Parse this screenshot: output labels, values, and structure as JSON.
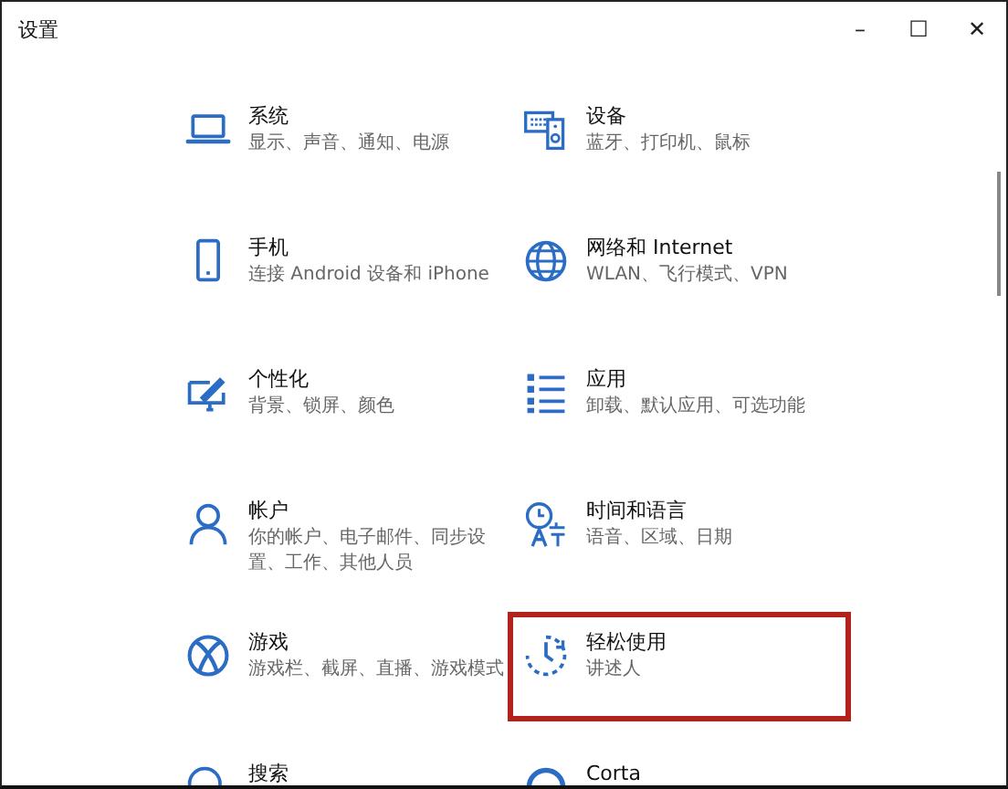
{
  "window": {
    "title": "设置",
    "controls": [
      "–",
      "☐",
      "✕"
    ]
  },
  "categories": [
    {
      "kind": "laptop",
      "title": "系统",
      "subtitle": "显示、声音、通知、电源",
      "highlighted": false
    },
    {
      "kind": "devices",
      "title": "设备",
      "subtitle": "蓝牙、打印机、鼠标",
      "highlighted": false
    },
    {
      "kind": "phone",
      "title": "手机",
      "subtitle": "连接 Android 设备和 iPhone",
      "highlighted": false
    },
    {
      "kind": "globe",
      "title": "网络和 Internet",
      "subtitle": "WLAN、飞行模式、VPN",
      "highlighted": false
    },
    {
      "kind": "personalize",
      "title": "个性化",
      "subtitle": "背景、锁屏、颜色",
      "highlighted": false
    },
    {
      "kind": "apps",
      "title": "应用",
      "subtitle": "卸载、默认应用、可选功能",
      "highlighted": false
    },
    {
      "kind": "account",
      "title": "帐户",
      "subtitle": "你的帐户、电子邮件、同步设置、工作、其他人员",
      "highlighted": false
    },
    {
      "kind": "time",
      "title": "时间和语言",
      "subtitle": "语音、区域、日期",
      "highlighted": false
    },
    {
      "kind": "xbox",
      "title": "游戏",
      "subtitle": "游戏栏、截屏、直播、游戏模式",
      "highlighted": false
    },
    {
      "kind": "ease",
      "title": "轻松使用",
      "subtitle": "讲述人",
      "highlighted": true
    },
    {
      "kind": "search",
      "title": "搜索",
      "highlighted": false
    },
    {
      "kind": "cortana",
      "title": "Corta",
      "highlighted": false
    }
  ]
}
